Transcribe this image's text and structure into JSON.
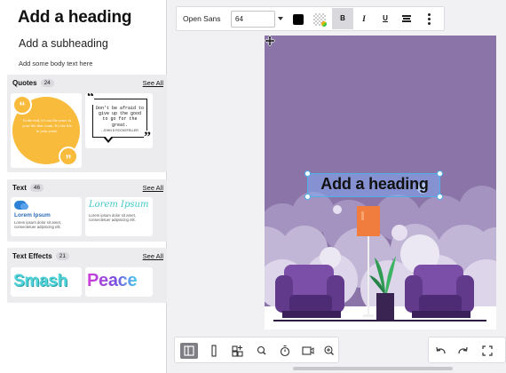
{
  "text_presets": {
    "heading": "Add a heading",
    "subheading": "Add a subheading",
    "body": "Add some body text here"
  },
  "sections": {
    "quotes": {
      "title": "Quotes",
      "count": "24",
      "see_all": "See All",
      "card1_text": "In the end, it's not the years in your life that count. It's the life in your years.",
      "card1_author": "— Abraham Lincoln",
      "card2_text": "Don't be afraid to give up the good to go for the great.",
      "card2_author": "- JOHN D ROCKEFELLER"
    },
    "text": {
      "title": "Text",
      "count": "46",
      "see_all": "See All",
      "card1_title": "Lorem Ipsum",
      "card1_body": "Lorem ipsum dolor sit amet, consectetuer adipiscing elit.",
      "card2_title": "Lorem Ipsum",
      "card2_body": "Lorem ipsum dolor sit amet, consectetuer adipiscing elit."
    },
    "effects": {
      "title": "Text Effects",
      "count": "21",
      "see_all": "See All",
      "effect1": "Smash",
      "effect2": "Peace"
    }
  },
  "toolbar": {
    "font_family": "Open Sans",
    "font_size": "64",
    "text_color": "#000000",
    "bold": "B",
    "italic": "I",
    "underline": "U"
  },
  "canvas": {
    "heading_text": "Add a heading",
    "background": "#8a74a8"
  },
  "bottom_left_icons": [
    "layout-icon",
    "page-icon",
    "add-page-icon",
    "zoom-icon",
    "timer-icon",
    "video-icon",
    "zoom-in-icon"
  ],
  "bottom_right_icons": [
    "undo-icon",
    "redo-icon",
    "fullscreen-icon"
  ]
}
